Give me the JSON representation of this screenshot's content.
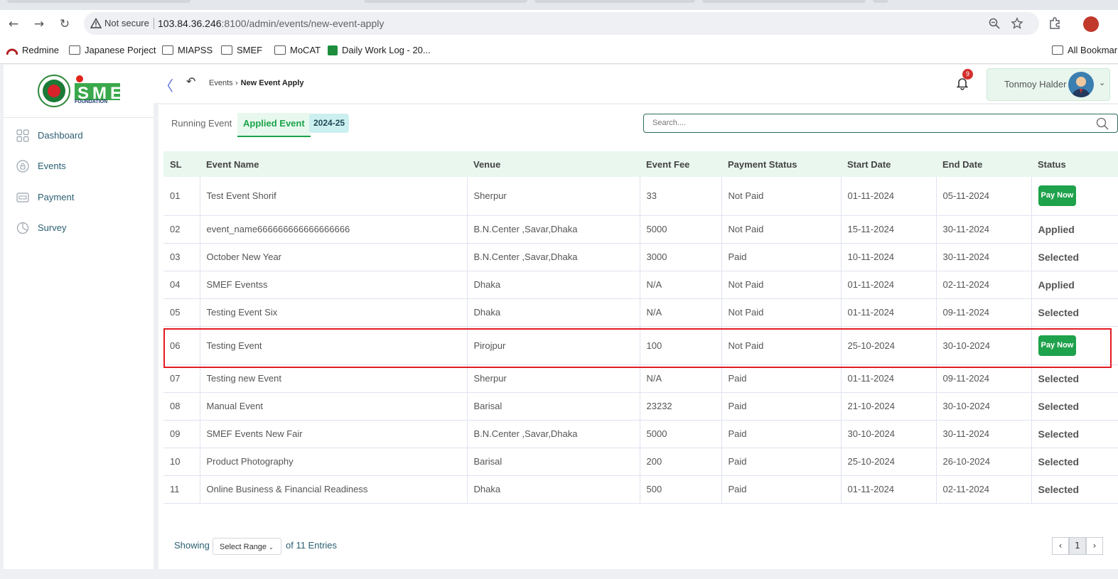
{
  "browser": {
    "not_secure": "Not secure",
    "url_host": "103.84.36.246",
    "url_rest": ":8100/admin/events/new-event-apply",
    "bookmarks": [
      "Redmine",
      "Japanese Porject",
      "MIAPSS",
      "SMEF",
      "MoCAT",
      "Daily Work Log - 20...",
      "All Bookmar"
    ]
  },
  "logo": {
    "text": "SME",
    "sub": "FOUNDATION"
  },
  "sidebar": {
    "items": [
      {
        "label": "Dashboard",
        "icon": "grid-icon"
      },
      {
        "label": "Events",
        "icon": "lock-icon"
      },
      {
        "label": "Payment",
        "icon": "card-icon"
      },
      {
        "label": "Survey",
        "icon": "pie-icon"
      }
    ]
  },
  "header": {
    "breadcrumb_parent": "Events",
    "breadcrumb_current": "New Event Apply",
    "notification_count": "9",
    "user_name": "Tonmoy Halder"
  },
  "tabs": {
    "running": "Running Event",
    "applied": "Applied Event",
    "year": "2024-25"
  },
  "search": {
    "placeholder": "Search...."
  },
  "table": {
    "columns": [
      "SL",
      "Event Name",
      "Venue",
      "Event Fee",
      "Payment Status",
      "Start Date",
      "End Date",
      "Status"
    ],
    "pay_now_label": "Pay Now",
    "rows": [
      {
        "sl": "01",
        "name": "Test Event Shorif",
        "venue": "Sherpur",
        "fee": "33",
        "payment": "Not Paid",
        "start": "01-11-2024",
        "end": "05-11-2024",
        "status": "Pay Now"
      },
      {
        "sl": "02",
        "name": "event_name666666666666666666",
        "venue": "B.N.Center ,Savar,Dhaka",
        "fee": "5000",
        "payment": "Not Paid",
        "start": "15-11-2024",
        "end": "30-11-2024",
        "status": "Applied"
      },
      {
        "sl": "03",
        "name": "October New Year",
        "venue": "B.N.Center ,Savar,Dhaka",
        "fee": "3000",
        "payment": "Paid",
        "start": "10-11-2024",
        "end": "30-11-2024",
        "status": "Selected"
      },
      {
        "sl": "04",
        "name": "SMEF Eventss",
        "venue": "Dhaka",
        "fee": "N/A",
        "payment": "Not Paid",
        "start": "01-11-2024",
        "end": "02-11-2024",
        "status": "Applied"
      },
      {
        "sl": "05",
        "name": "Testing Event Six",
        "venue": "Dhaka",
        "fee": "N/A",
        "payment": "Not Paid",
        "start": "01-11-2024",
        "end": "09-11-2024",
        "status": "Selected"
      },
      {
        "sl": "06",
        "name": "Testing Event",
        "venue": "Pirojpur",
        "fee": "100",
        "payment": "Not Paid",
        "start": "25-10-2024",
        "end": "30-10-2024",
        "status": "Pay Now"
      },
      {
        "sl": "07",
        "name": "Testing new Event",
        "venue": "Sherpur",
        "fee": "N/A",
        "payment": "Paid",
        "start": "01-11-2024",
        "end": "09-11-2024",
        "status": "Selected"
      },
      {
        "sl": "08",
        "name": "Manual Event",
        "venue": "Barisal",
        "fee": "23232",
        "payment": "Paid",
        "start": "21-10-2024",
        "end": "30-10-2024",
        "status": "Selected"
      },
      {
        "sl": "09",
        "name": "SMEF Events New Fair",
        "venue": "B.N.Center ,Savar,Dhaka",
        "fee": "5000",
        "payment": "Paid",
        "start": "30-10-2024",
        "end": "30-11-2024",
        "status": "Selected"
      },
      {
        "sl": "10",
        "name": "Product Photography",
        "venue": "Barisal",
        "fee": "200",
        "payment": "Paid",
        "start": "25-10-2024",
        "end": "26-10-2024",
        "status": "Selected"
      },
      {
        "sl": "11",
        "name": "Online Business & Financial Readiness",
        "venue": "Dhaka",
        "fee": "500",
        "payment": "Paid",
        "start": "01-11-2024",
        "end": "02-11-2024",
        "status": "Selected"
      }
    ]
  },
  "footer": {
    "showing": "Showing",
    "range_select": "Select Range",
    "entries": "of 11 Entries",
    "current_page": "1"
  },
  "colors": {
    "accent_green": "#1ea24b",
    "header_row": "#e9f7ef",
    "highlight_border": "#e31b23",
    "nav_text": "#2a5f72"
  }
}
